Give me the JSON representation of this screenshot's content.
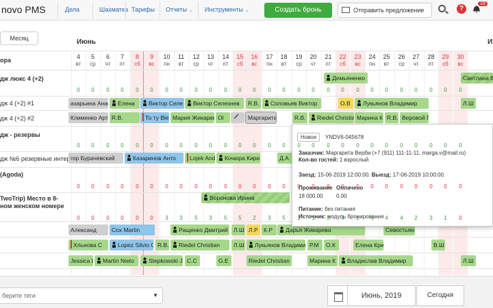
{
  "header": {
    "logo": "novo PMS",
    "nav": [
      {
        "label": "Дела",
        "chev": false
      },
      {
        "label": "Шахматка",
        "chev": false
      },
      {
        "label": "Тарифы",
        "chev": false
      },
      {
        "label": "Отчеты",
        "chev": true
      },
      {
        "label": "Инструменты",
        "chev": true
      }
    ],
    "create_label": "Создать бронь",
    "offer_label": "Отправить предложение",
    "notif_count": "19",
    "help_glyph": "?"
  },
  "view": {
    "month_button": "Месяц",
    "month_label": "Июнь",
    "next_month_label": "Июл"
  },
  "days": [
    {
      "n": "4",
      "w": "вт"
    },
    {
      "n": "5",
      "w": "ср"
    },
    {
      "n": "6",
      "w": "чт"
    },
    {
      "n": "7",
      "w": "пт"
    },
    {
      "n": "8",
      "w": "сб"
    },
    {
      "n": "9",
      "w": "вс"
    },
    {
      "n": "10",
      "w": "пн"
    },
    {
      "n": "11",
      "w": "вт"
    },
    {
      "n": "12",
      "w": "ср"
    },
    {
      "n": "13",
      "w": "чт"
    },
    {
      "n": "14",
      "w": "пт"
    },
    {
      "n": "15",
      "w": "сб"
    },
    {
      "n": "16",
      "w": "вс"
    },
    {
      "n": "17",
      "w": "пн"
    },
    {
      "n": "18",
      "w": "вт"
    },
    {
      "n": "19",
      "w": "ср"
    },
    {
      "n": "20",
      "w": "чт"
    },
    {
      "n": "21",
      "w": "пт"
    },
    {
      "n": "22",
      "w": "сб"
    },
    {
      "n": "23",
      "w": "вс"
    },
    {
      "n": "24",
      "w": "пн"
    },
    {
      "n": "25",
      "w": "вт"
    },
    {
      "n": "26",
      "w": "ср"
    },
    {
      "n": "27",
      "w": "чт"
    },
    {
      "n": "28",
      "w": "пт"
    },
    {
      "n": "29",
      "w": "сб"
    },
    {
      "n": "30",
      "w": "вс"
    }
  ],
  "labels": {
    "col_head": "ора",
    "cat1": "дж люкс 4 (+2)",
    "room1": "дж 4 (+2) #1",
    "room2": "дж 4 (+2) #2",
    "cat2": "дж - резервы",
    "room3": "дж №6 резервные интер...",
    "cat3": "(Agoda)",
    "cat4a": "TwoTrip) Место в 8-",
    "cat4b": "ном женском номере"
  },
  "counts": {
    "cat1": [
      "0",
      "0",
      "0",
      "0",
      "0",
      "0",
      "0",
      "0",
      "0",
      "0",
      "0",
      "0",
      "0",
      "0",
      "0",
      "0",
      "0",
      "0",
      "0",
      "0",
      "0",
      "0",
      "0",
      "0",
      "0",
      "0",
      "0"
    ],
    "cat2": [
      "0",
      "0",
      "0",
      "0",
      "0",
      "0",
      "0",
      "0",
      "0",
      "0",
      "0",
      "0",
      "0",
      "0",
      "0",
      "0",
      "0",
      "0",
      "0",
      "0",
      "0",
      "0",
      "0",
      "0",
      "0",
      "0",
      "0"
    ],
    "cat3": [
      "0",
      "0",
      "0",
      "0",
      "0",
      "0",
      "0",
      "0",
      "0",
      "0",
      "0",
      "0",
      "0",
      "0",
      "0",
      "0",
      "0",
      "0",
      "0",
      "0",
      "0",
      "0",
      "0",
      "0",
      "0",
      "0",
      "0"
    ],
    "cat4": [
      "0",
      "0",
      "0",
      "0",
      "0",
      "0",
      "3",
      "3",
      "5",
      "3",
      "5",
      "5",
      "2",
      "3",
      "5",
      "1",
      "3",
      "3",
      "4",
      "1",
      "6",
      "4",
      "4",
      "2",
      "3",
      "1",
      "0"
    ]
  },
  "bookings": {
    "b1": "Демьяненко",
    "b2": "Светлана Ва",
    "b3": "азарьина Анас",
    "b4": "Елена",
    "b5": "Виктор Селе",
    "b6": "Виктор Селезнев",
    "b7": "R.B.",
    "b8": "Соловьев Виктор",
    "b9": "О.В",
    "b10": "Лукьянов Владимир",
    "b11": "Л.Ш",
    "b12": "Клименко Арте",
    "b13": "R.B.",
    "b14": "То ту Blerto",
    "b15": "Мария Жикарев",
    "b16": "Ol",
    "b17": "Маргарита",
    "b18": "R.B.",
    "b19": "Riedel Christian",
    "b20": "Марина К",
    "b21": "R.B.",
    "b22": "Веровой Г",
    "b23": "гор Бурачевский",
    "b24": "Казаринов Анто",
    "b25": "Lojek Andr",
    "b26": "Кочюра Кири",
    "b27": "Д.А",
    "b28": "Воронова Ирина",
    "b29": "Александ",
    "b30": "Cox Martin",
    "b31": "Ращенко Дмитрий",
    "b32": "Л.Ш",
    "b33": "Л.Р",
    "b34": "К.Р",
    "b35": "Дарья Жикарева",
    "b36": "Севостьян",
    "b37": "Хльнова С",
    "b38": "Lopez Silvio C",
    "b39": "R.B.",
    "b40": "Riedel Christian",
    "b41": "Л.Ш",
    "b42": "Лукьянов Владимир",
    "b43": "Р.М",
    "b44": "О.К",
    "b45": "Елена Кри",
    "b46": "В.Ш",
    "b47": "Jessica L",
    "b48": "Martin Nieto",
    "b49": "Stepkowski J",
    "b50": "C.C",
    "b51": "G.E",
    "b52": "Riedel Christian",
    "b53": "Марина К",
    "b54": "Владислав Владимир",
    "b55": "Л.Ш"
  },
  "popup": {
    "status": "Новое",
    "booking_id": "YNDV6-045678",
    "customer_label": "Заказчик:",
    "customer_value": "Маргарита Верби  (+7 (911) 111-11-11, marga.v@mail.ru)",
    "guests_label": "Кол-во гостей:",
    "guests_value": "1 взрослый",
    "checkin_label": "Заезд:",
    "checkin_value": "15-06-2019 12:00:00.",
    "checkout_label": "Выезд:",
    "checkout_value": "17-06-2019 10:00:00.",
    "stay_label": "Проживание",
    "paid_label": "Оплачено",
    "stay_value": "18 000.00",
    "paid_value": "0.00",
    "meals_label": "Питание:",
    "meals_value": "без питания",
    "source_label": "Источник:",
    "source_value": "модуль бронирования"
  },
  "footer": {
    "tags_placeholder": "берите теги",
    "month_value": "Июнь, 2019",
    "today_label": "Сегодня"
  },
  "colors": {
    "accent_green": "#3faa3f",
    "booking_green": "#a6d88a",
    "booking_blue": "#8ec5ea",
    "weekend": "#fdeaea",
    "alert_red": "#d33"
  }
}
